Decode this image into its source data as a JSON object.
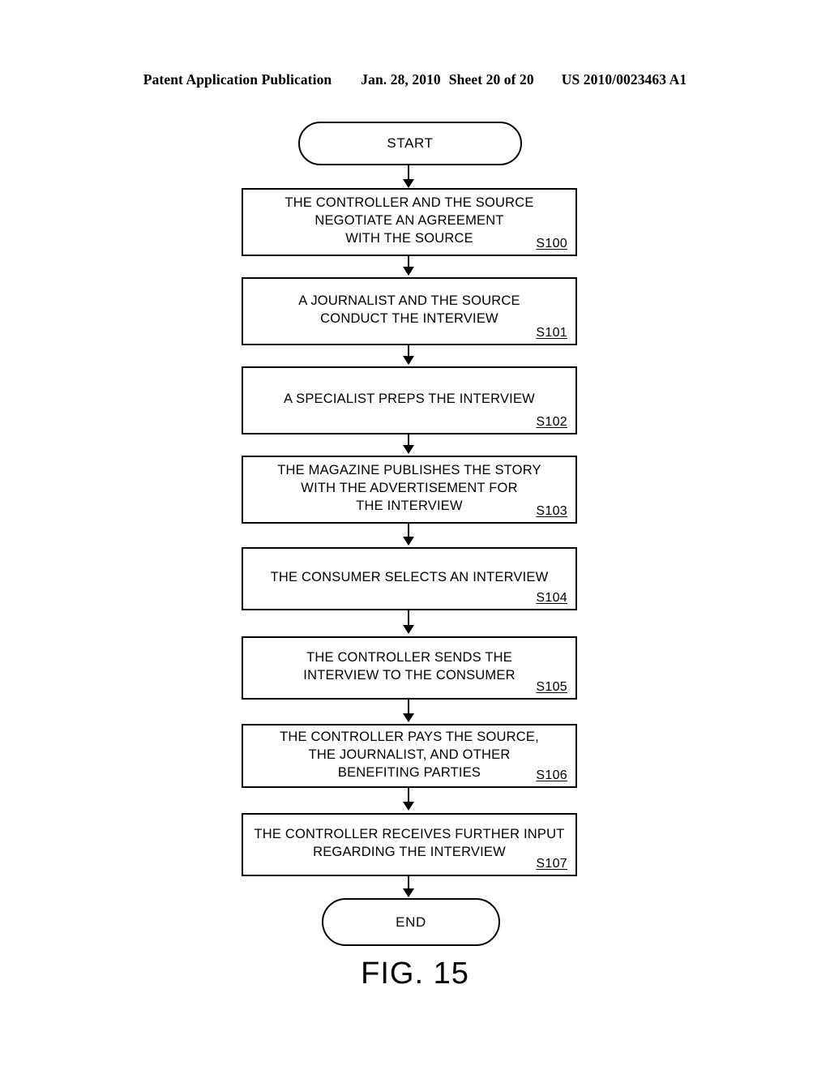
{
  "header": {
    "publication": "Patent Application Publication",
    "date": "Jan. 28, 2010",
    "sheet": "Sheet 20 of 20",
    "doc_number": "US 2010/0023463 A1"
  },
  "figure": {
    "caption": "FIG. 15",
    "title": "",
    "ink_color": "#000000",
    "background_color": "#ffffff"
  },
  "flowchart": {
    "start": {
      "label": "START",
      "shape": "terminator"
    },
    "end": {
      "label": "END",
      "shape": "terminator"
    },
    "steps": [
      {
        "id": "S100",
        "shape": "process",
        "lines": [
          "THE CONTROLLER AND THE SOURCE",
          "NEGOTIATE AN AGREEMENT",
          "WITH THE SOURCE"
        ]
      },
      {
        "id": "S101",
        "shape": "process",
        "lines": [
          "A JOURNALIST AND THE SOURCE",
          "CONDUCT THE INTERVIEW"
        ]
      },
      {
        "id": "S102",
        "shape": "process",
        "lines": [
          "A SPECIALIST PREPS THE INTERVIEW"
        ]
      },
      {
        "id": "S103",
        "shape": "process",
        "lines": [
          "THE MAGAZINE PUBLISHES THE STORY",
          "WITH THE ADVERTISEMENT FOR",
          "THE INTERVIEW"
        ]
      },
      {
        "id": "S104",
        "shape": "process",
        "lines": [
          "THE CONSUMER SELECTS AN INTERVIEW"
        ]
      },
      {
        "id": "S105",
        "shape": "process",
        "lines": [
          "THE CONTROLLER SENDS THE",
          "INTERVIEW TO THE CONSUMER"
        ]
      },
      {
        "id": "S106",
        "shape": "process",
        "lines": [
          "THE CONTROLLER PAYS THE SOURCE,",
          "THE JOURNALIST, AND OTHER",
          "BENEFITING PARTIES"
        ]
      },
      {
        "id": "S107",
        "shape": "process",
        "lines": [
          "THE CONTROLLER RECEIVES FURTHER INPUT",
          "REGARDING THE INTERVIEW"
        ]
      }
    ]
  }
}
